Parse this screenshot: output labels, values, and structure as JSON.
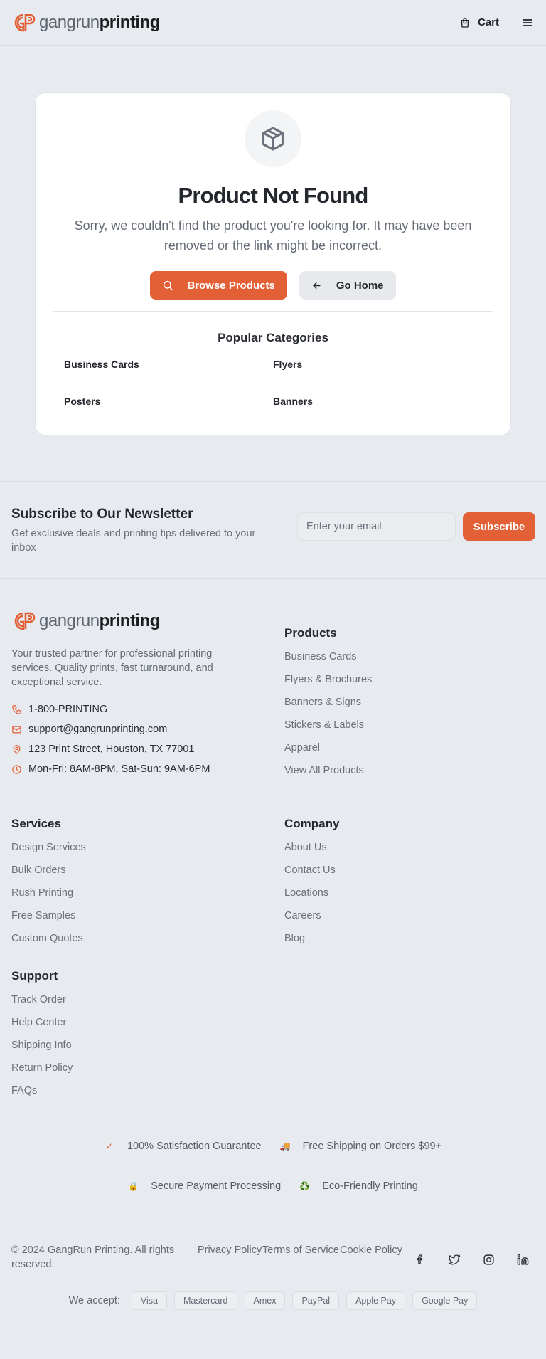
{
  "header": {
    "logo_part1": "gangrun",
    "logo_part2": "printing",
    "cart_label": "Cart"
  },
  "not_found": {
    "title": "Product Not Found",
    "message": "Sorry, we couldn't find the product you're looking for. It may have been removed or the link might be incorrect.",
    "browse_label": "Browse Products",
    "home_label": "Go Home",
    "categories_title": "Popular Categories",
    "categories": [
      "Business Cards",
      "Flyers",
      "Posters",
      "Banners"
    ]
  },
  "newsletter": {
    "title": "Subscribe to Our Newsletter",
    "subtitle": "Get exclusive deals and printing tips delivered to your inbox",
    "email_placeholder": "Enter your email",
    "subscribe_label": "Subscribe"
  },
  "footer": {
    "description": "Your trusted partner for professional printing services. Quality prints, fast turnaround, and exceptional service.",
    "phone": "1-800-PRINTING",
    "email": "support@gangrunprinting.com",
    "address": "123 Print Street, Houston, TX 77001",
    "hours": "Mon-Fri: 8AM-8PM, Sat-Sun: 9AM-6PM",
    "products": {
      "title": "Products",
      "links": [
        "Business Cards",
        "Flyers & Brochures",
        "Banners & Signs",
        "Stickers & Labels",
        "Apparel",
        "View All Products"
      ]
    },
    "services": {
      "title": "Services",
      "links": [
        "Design Services",
        "Bulk Orders",
        "Rush Printing",
        "Free Samples",
        "Custom Quotes"
      ]
    },
    "company": {
      "title": "Company",
      "links": [
        "About Us",
        "Contact Us",
        "Locations",
        "Careers",
        "Blog"
      ]
    },
    "support": {
      "title": "Support",
      "links": [
        "Track Order",
        "Help Center",
        "Shipping Info",
        "Return Policy",
        "FAQs"
      ]
    },
    "trust": [
      "100% Satisfaction Guarantee",
      "Free Shipping on Orders $99+",
      "Secure Payment Processing",
      "Eco-Friendly Printing"
    ],
    "trust_icons": [
      "✓",
      "🚚",
      "🔒",
      "♻️"
    ],
    "copyright": "© 2024 GangRun Printing. All rights reserved.",
    "legal": [
      "Privacy Policy",
      "Terms of Service",
      "Cookie Policy"
    ],
    "socials": [
      "facebook-icon",
      "twitter-icon",
      "instagram-icon",
      "linkedin-icon"
    ],
    "pay_label": "We accept:",
    "payments": [
      "Visa",
      "Mastercard",
      "Amex",
      "PayPal",
      "Apple Pay",
      "Google Pay"
    ]
  },
  "colors": {
    "accent": "#e35f35",
    "background": "#e7eaee",
    "card": "#ffffff",
    "text": "#24272d",
    "muted": "#6a707b"
  }
}
